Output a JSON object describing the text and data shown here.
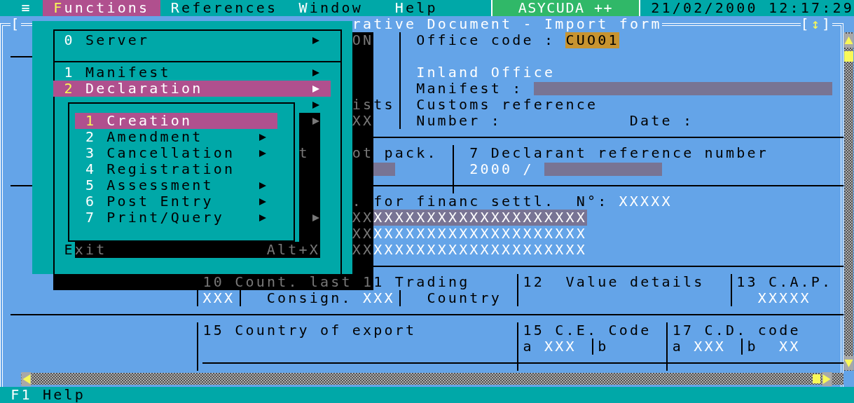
{
  "menu_bar": {
    "system_menu": "≡",
    "items": [
      {
        "label": "Functions",
        "selected": true
      },
      {
        "label": "References",
        "selected": false
      },
      {
        "label": "Window",
        "selected": false
      },
      {
        "label": "Help",
        "selected": false
      }
    ],
    "app_name": "ASYCUDA ++",
    "clock": "21/02/2000 12:17:29"
  },
  "window": {
    "close_button": "[",
    "title": "rative Document - Import form",
    "zoom_button": "[↕]"
  },
  "form": {
    "texts": [
      {
        "kind": "dim",
        "text": "ON"
      },
      {
        "kind": "label",
        "text": "Office code :"
      },
      {
        "kind": "code",
        "text": "CUO01"
      },
      {
        "kind": "value",
        "text": "Inland Office"
      },
      {
        "kind": "label",
        "text": "Manifest :"
      },
      {
        "kind": "dim",
        "text": "is"
      },
      {
        "kind": "label",
        "text": "ts"
      },
      {
        "kind": "label",
        "text": "Customs reference"
      },
      {
        "kind": "dim",
        "text": "XX"
      },
      {
        "kind": "label",
        "text": "Number :"
      },
      {
        "kind": "label",
        "text": "Date :"
      },
      {
        "kind": "dim",
        "text": "t"
      },
      {
        "kind": "dim",
        "text": "ot"
      },
      {
        "kind": "label",
        "text": "pack."
      },
      {
        "kind": "label",
        "text": "7 Declarant reference number"
      },
      {
        "kind": "value",
        "text": "2000 /"
      },
      {
        "kind": "dim",
        "text": "."
      },
      {
        "kind": "label",
        "text": "for financ settl.  N°:"
      },
      {
        "kind": "value",
        "text": "XXXXX"
      },
      {
        "kind": "dim",
        "text": "XX"
      },
      {
        "kind": "focused",
        "text": "XXXXXXXXXXXXXXXXXXXX"
      },
      {
        "kind": "dim",
        "text": "XX"
      },
      {
        "kind": "value",
        "text": "XXXXXXXXXXXXXXXXXXXX"
      },
      {
        "kind": "dim",
        "text": "XX"
      },
      {
        "kind": "value",
        "text": "XXXXXXXXXXXXXXXXXXXX"
      },
      {
        "kind": "dim",
        "text": "10 Count. last"
      },
      {
        "kind": "dim",
        "text": "1"
      },
      {
        "kind": "label",
        "text": "1 Trading"
      },
      {
        "kind": "label",
        "text": "12  Value details"
      },
      {
        "kind": "label",
        "text": "13 C.A.P."
      },
      {
        "kind": "value",
        "text": "XXX"
      },
      {
        "kind": "label",
        "text": "Consign."
      },
      {
        "kind": "value",
        "text": "XXX"
      },
      {
        "kind": "label",
        "text": "Country"
      },
      {
        "kind": "value",
        "text": "XXXXX"
      },
      {
        "kind": "label",
        "text": "15 Country of export"
      },
      {
        "kind": "label",
        "text": "15 C.E. Code"
      },
      {
        "kind": "label",
        "text": "17 C.D. code"
      },
      {
        "kind": "label",
        "text": "a"
      },
      {
        "kind": "value",
        "text": "XXX"
      },
      {
        "kind": "label",
        "text": "b"
      },
      {
        "kind": "label",
        "text": "a"
      },
      {
        "kind": "value",
        "text": "XXX"
      },
      {
        "kind": "label",
        "text": "b"
      },
      {
        "kind": "value",
        "text": "XX"
      }
    ]
  },
  "functions_menu": {
    "items": [
      {
        "label": "0 Server",
        "submenu": true,
        "selected": false
      },
      {
        "label": "1 Manifest",
        "submenu": true,
        "selected": false
      },
      {
        "label": "2 Declaration",
        "submenu": true,
        "selected": true
      }
    ],
    "exit": {
      "label": "Exit",
      "shortcut": "Alt+X"
    }
  },
  "declaration_submenu": {
    "items": [
      {
        "label": "1 Creation",
        "submenu": false,
        "selected": true
      },
      {
        "label": "2 Amendment",
        "submenu": true,
        "selected": false
      },
      {
        "label": "3 Cancellation",
        "submenu": true,
        "selected": false
      },
      {
        "label": "4 Registration",
        "submenu": false,
        "selected": false
      },
      {
        "label": "5 Assessment",
        "submenu": true,
        "selected": false
      },
      {
        "label": "6 Post Entry",
        "submenu": true,
        "selected": false
      },
      {
        "label": "7 Print/Query",
        "submenu": true,
        "selected": false
      }
    ]
  },
  "status_bar": {
    "key": "F1",
    "label": "Help"
  }
}
